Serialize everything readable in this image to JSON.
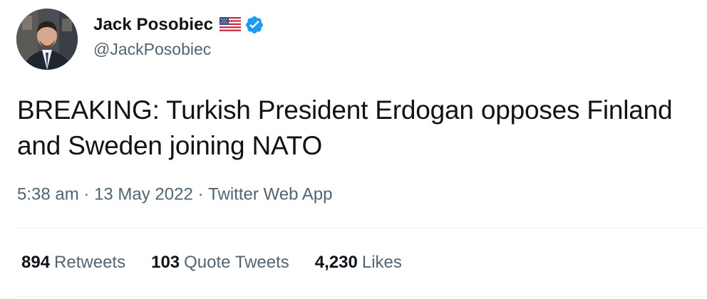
{
  "author": {
    "display_name": "Jack Posobiec",
    "handle": "@JackPosobiec",
    "flag_icon": "us-flag-icon",
    "verified_icon": "verified-badge-icon",
    "verified_color": "#1d9bf0"
  },
  "tweet": {
    "text": "BREAKING: Turkish President Erdogan opposes Finland and Sweden joining NATO"
  },
  "meta": {
    "time": "5:38 am",
    "separator_1": "·",
    "date": "13 May 2022",
    "separator_2": "·",
    "source": "Twitter Web App"
  },
  "stats": {
    "retweets_count": "894",
    "retweets_label": "Retweets",
    "quotes_count": "103",
    "quotes_label": "Quote Tweets",
    "likes_count": "4,230",
    "likes_label": "Likes"
  },
  "colors": {
    "primary_text": "#0f1419",
    "secondary_text": "#536471",
    "divider": "#eff3f4"
  }
}
